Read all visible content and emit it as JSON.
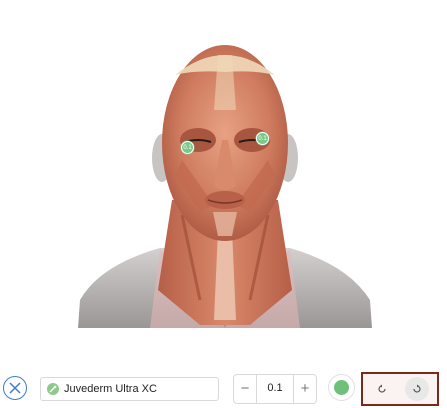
{
  "canvas": {
    "image": "anatomical head and neck muscle illustration",
    "markers": [
      {
        "label": "0.1"
      },
      {
        "label": "0.1"
      }
    ]
  },
  "toolbar": {
    "close_icon": "close-icon",
    "product": {
      "icon": "syringe-icon",
      "name": "Juvederm Ultra XC"
    },
    "stepper": {
      "minus_label": "−",
      "value": "0.1",
      "plus_label": "+"
    },
    "color": {
      "icon": "color-dot-icon",
      "value": "#6fc07a"
    },
    "undo_icon": "undo-icon",
    "redo_icon": "redo-icon"
  },
  "colors": {
    "accent_blue": "#3e7bd1",
    "marker_green": "#7ac98a",
    "highlight_border": "#7a2a1c"
  }
}
